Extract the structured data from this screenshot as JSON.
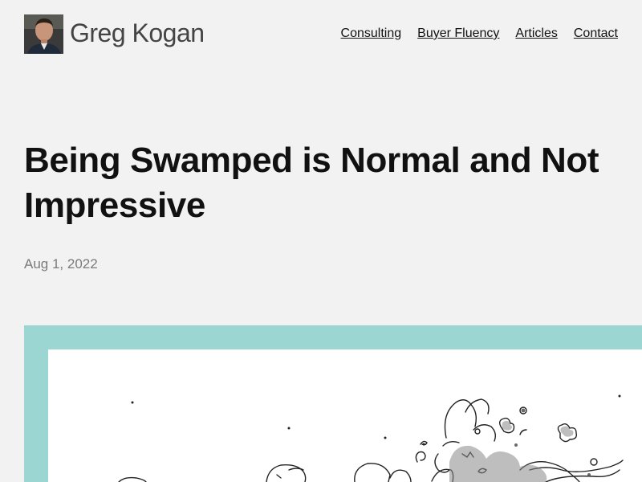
{
  "header": {
    "site_name": "Greg Kogan",
    "nav": [
      {
        "label": "Consulting"
      },
      {
        "label": "Buyer Fluency"
      },
      {
        "label": "Articles"
      },
      {
        "label": "Contact"
      }
    ]
  },
  "article": {
    "title": "Being Swamped is Normal and Not Impressive",
    "date": "Aug 1, 2022"
  },
  "colors": {
    "page_background": "#f2f2f2",
    "hero_frame": "#9bd6d3",
    "date_text": "#7a7a7a"
  },
  "icons": {
    "avatar": "author-photo",
    "illustration": "swamped-cartoon-illustration"
  }
}
